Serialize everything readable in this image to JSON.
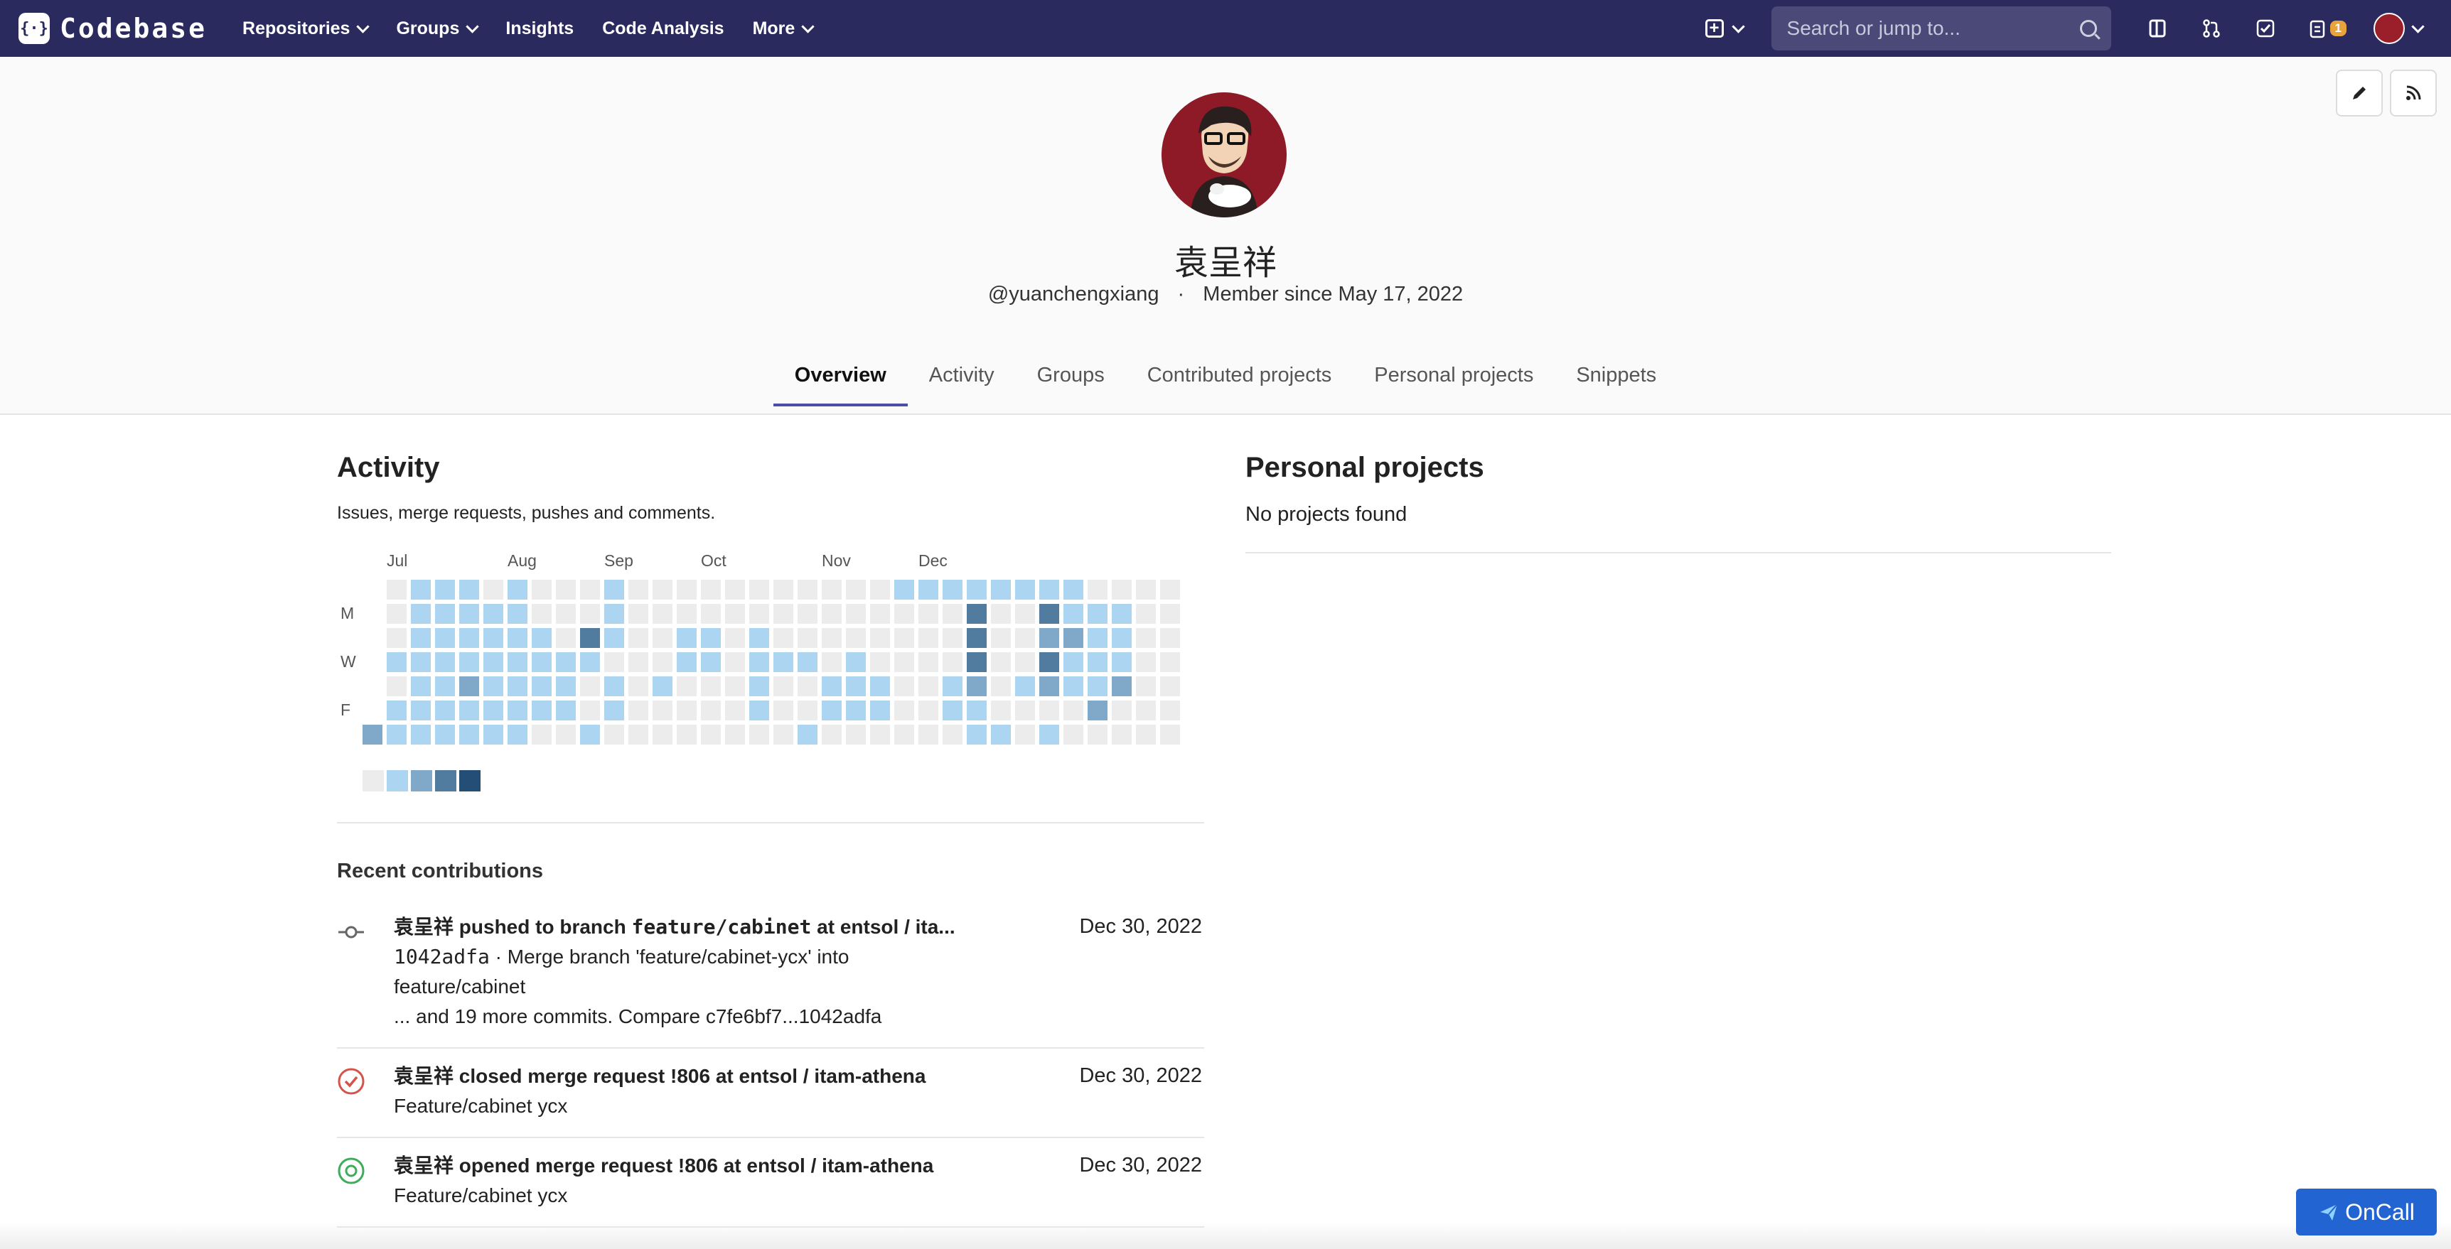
{
  "nav": {
    "logo_mark": "{·}",
    "logo_text": "Codebase",
    "items": [
      "Repositories",
      "Groups",
      "Insights",
      "Code Analysis",
      "More"
    ],
    "search_placeholder": "Search or jump to...",
    "todo_count": "1"
  },
  "profile": {
    "name": "袁呈祥",
    "handle": "@yuanchengxiang",
    "separator": "·",
    "member_since": "Member since May 17, 2022",
    "tabs": [
      "Overview",
      "Activity",
      "Groups",
      "Contributed projects",
      "Personal projects",
      "Snippets"
    ],
    "active_tab": "Overview"
  },
  "activity": {
    "title": "Activity",
    "subtitle": "Issues, merge requests, pushes and comments.",
    "months": [
      "Jul",
      "Aug",
      "Sep",
      "Oct",
      "Nov",
      "Dec"
    ],
    "day_labels": [
      "M",
      "W",
      "F"
    ],
    "colors": {
      "empty": "#ececec",
      "level1": "#acd5f2",
      "level2": "#7fa8c9",
      "level3": "#527ba0",
      "level4": "#254e77"
    },
    "heatmap_weeks": [
      "______2",
      "0001011",
      "1111111",
      "1111111",
      "1111211",
      "0111111",
      "1111111",
      "0011110",
      "0001110",
      "0031001",
      "1110110",
      "0000000",
      "0000100",
      "0011000",
      "0011000",
      "0000000",
      "0011110",
      "0001000",
      "0001001",
      "0000110",
      "0001110",
      "0000110",
      "1000000",
      "1000000",
      "1000110",
      "1333211",
      "1000001",
      "1000100",
      "1323201",
      "1121100",
      "0111120",
      "0111200",
      "0000000",
      "0000000"
    ],
    "legend": [
      "empty",
      "level1",
      "level2",
      "level3",
      "level4"
    ]
  },
  "recent": {
    "title": "Recent contributions",
    "events": [
      {
        "icon": "commit-icon",
        "actor": "袁呈祥",
        "action": "pushed to branch",
        "branch": "feature/cabinet",
        "target_prefix": "at",
        "target": "entsol / ita...",
        "line2_sha": "1042adfa",
        "line2_text": "· Merge branch 'feature/cabinet-ycx' into",
        "line3": "feature/cabinet",
        "line4": "... and 19 more commits. Compare c7fe6bf7...1042adfa",
        "time": "Dec 30, 2022"
      },
      {
        "icon": "mr-closed-icon",
        "actor": "袁呈祥",
        "action": "closed",
        "target": "merge request !806 at entsol / itam-athena",
        "detail": "Feature/cabinet ycx",
        "time": "Dec 30, 2022"
      },
      {
        "icon": "mr-opened-icon",
        "actor": "袁呈祥",
        "action": "opened",
        "target": "merge request !806 at entsol / itam-athena",
        "detail": "Feature/cabinet ycx",
        "time": "Dec 30, 2022"
      }
    ]
  },
  "personal_projects": {
    "title": "Personal projects",
    "empty_text": "No projects found"
  },
  "oncall": {
    "label": "OnCall"
  }
}
